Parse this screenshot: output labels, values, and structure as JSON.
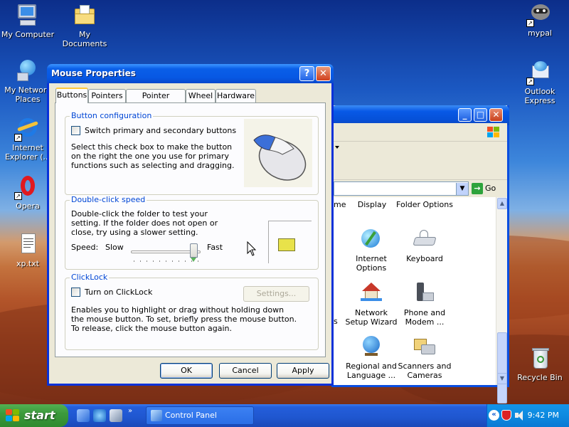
{
  "desktop": {
    "icons": [
      {
        "label": "My Computer",
        "icon": "computer-icon"
      },
      {
        "label": "My Documents",
        "icon": "documents-folder-icon"
      },
      {
        "label": "My Network Places",
        "icon": "network-places-icon"
      },
      {
        "label": "Internet Explorer (...",
        "icon": "internet-explorer-icon"
      },
      {
        "label": "Opera",
        "icon": "opera-icon"
      },
      {
        "label": "xp.txt",
        "icon": "text-file-icon"
      },
      {
        "label": "mypal",
        "icon": "raccoon-icon"
      },
      {
        "label": "Outlook Express",
        "icon": "outlook-express-icon"
      },
      {
        "label": "Recycle Bin",
        "icon": "recycle-bin-icon"
      }
    ]
  },
  "control_panel": {
    "go_label": "Go",
    "items": [
      {
        "label": "Display"
      },
      {
        "label": "Folder Options"
      },
      {
        "label": "Internet Options"
      },
      {
        "label": "Keyboard"
      },
      {
        "label": "Network Setup Wizard"
      },
      {
        "label": "Phone and Modem ..."
      },
      {
        "label": "Regional and Language ..."
      },
      {
        "label": "Scanners and Cameras"
      }
    ],
    "partial_labels": [
      "me",
      "s"
    ]
  },
  "dialog": {
    "title": "Mouse Properties",
    "help_label": "?",
    "close_label": "✕",
    "tabs": [
      "Buttons",
      "Pointers",
      "Pointer Options",
      "Wheel",
      "Hardware"
    ],
    "active_tab": "Buttons",
    "button_config": {
      "title": "Button configuration",
      "checkbox_label": "Switch primary and secondary buttons",
      "checked": false,
      "description": "Select this check box to make the button on the right the one you use for primary functions such as selecting and dragging."
    },
    "double_click": {
      "title": "Double-click speed",
      "description": "Double-click the folder to test your setting. If the folder does not open or close, try using a slower setting.",
      "speed_label": "Speed:",
      "slow_label": "Slow",
      "fast_label": "Fast",
      "speed_value_fraction": 0.95
    },
    "clicklock": {
      "title": "ClickLock",
      "checkbox_label": "Turn on ClickLock",
      "checked": false,
      "settings_label": "Settings...",
      "description": "Enables you to highlight or drag without holding down the mouse button. To set, briefly press the mouse button. To release, click the mouse button again."
    },
    "buttons": {
      "ok": "OK",
      "cancel": "Cancel",
      "apply": "Apply"
    }
  },
  "taskbar": {
    "start_label": "start",
    "task_item": "Control Panel",
    "clock": "9:42 PM",
    "colors": {
      "start": "#3c9a3c",
      "bar": "#245edb",
      "tray": "#0d8ae0"
    }
  }
}
